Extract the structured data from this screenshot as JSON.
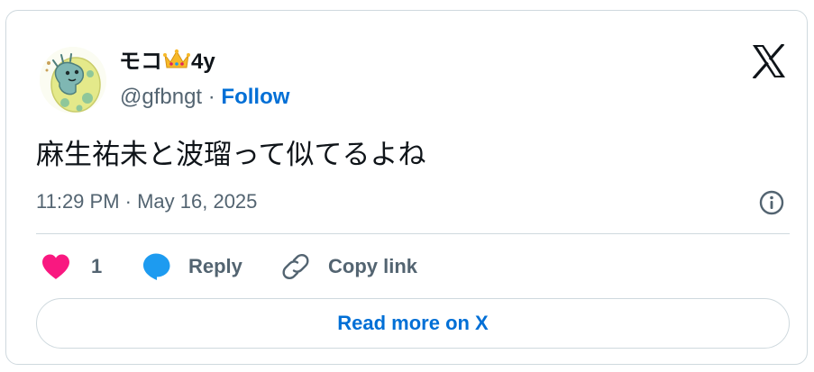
{
  "author": {
    "display_name_prefix": "モコ",
    "crown_icon": "crown-emoji",
    "display_name_suffix": "4y",
    "handle": "@gfbngt",
    "separator": " · ",
    "follow_label": "Follow",
    "avatar": "dinosaur-in-egg-avatar"
  },
  "brand": {
    "logo": "x-logo-icon"
  },
  "tweet": {
    "text": "麻生祐未と波瑠って似てるよね",
    "timestamp": "11:29 PM · May 16, 2025"
  },
  "actions": {
    "like_count": "1",
    "reply_label": "Reply",
    "copy_label": "Copy link"
  },
  "footer": {
    "read_more_label": "Read more on X"
  },
  "colors": {
    "like": "#f91880",
    "reply": "#1d9bf0",
    "link": "#006fd6",
    "secondary_text": "#536471",
    "primary_text": "#0f1419",
    "border": "#cfd9de"
  }
}
